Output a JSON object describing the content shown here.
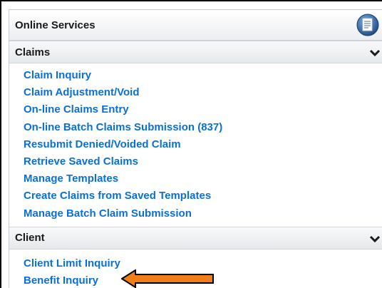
{
  "panel": {
    "title": "Online Services",
    "icon": "document-circle-icon"
  },
  "sections": [
    {
      "title": "Claims",
      "icon": "chevron-down-icon",
      "links": [
        "Claim Inquiry",
        "Claim Adjustment/Void",
        "On-line Claims Entry",
        "On-line Batch Claims Submission (837)",
        "Resubmit Denied/Voided Claim",
        "Retrieve Saved Claims",
        "Manage Templates",
        "Create Claims from Saved Templates",
        "Manage Batch Claim Submission"
      ]
    },
    {
      "title": "Client",
      "icon": "chevron-down-icon",
      "links": [
        "Client Limit Inquiry",
        "Benefit Inquiry"
      ]
    }
  ],
  "annotation": {
    "icon": "left-arrow-annotation",
    "color": "#f07f1a",
    "outline": "#000000"
  },
  "colors": {
    "link": "#0a6fd8",
    "header_bg": "#eceef1",
    "border": "#cfd4da"
  }
}
